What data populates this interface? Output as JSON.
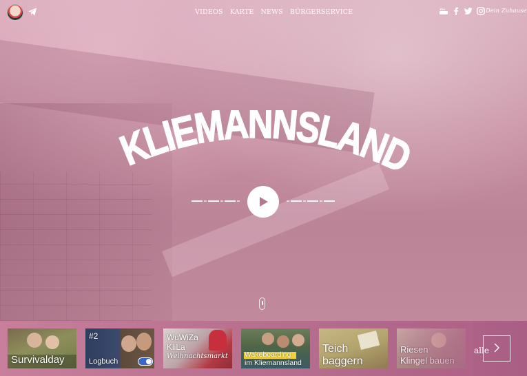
{
  "nav": {
    "items": [
      "VIDEOS",
      "KARTE",
      "NEWS",
      "BÜRGERSERVICE"
    ]
  },
  "header": {
    "tagline": "Dein Zuhause",
    "social_icons": [
      "youtube-icon",
      "facebook-icon",
      "twitter-icon",
      "instagram-icon"
    ]
  },
  "hero": {
    "title": "KLIEMANNSLAND"
  },
  "videos": [
    {
      "lines": [
        "Survivalday"
      ]
    },
    {
      "badge": "#2",
      "lines": [
        "Logbuch"
      ]
    },
    {
      "lines": [
        "WuWiZa",
        "KliLa",
        "Weihnachtsmarkt"
      ]
    },
    {
      "lines": [
        "Wakeboarding",
        "im Kliemannsland"
      ]
    },
    {
      "lines": [
        "Teich",
        "baggern"
      ]
    },
    {
      "lines": [
        "Riesen",
        "Klingel bauen"
      ]
    }
  ],
  "more": {
    "label": "alle"
  },
  "colors": {
    "overlay": "#c58b9e",
    "strip": "#b56c8d",
    "accent_yellow": "#f2d13b"
  }
}
